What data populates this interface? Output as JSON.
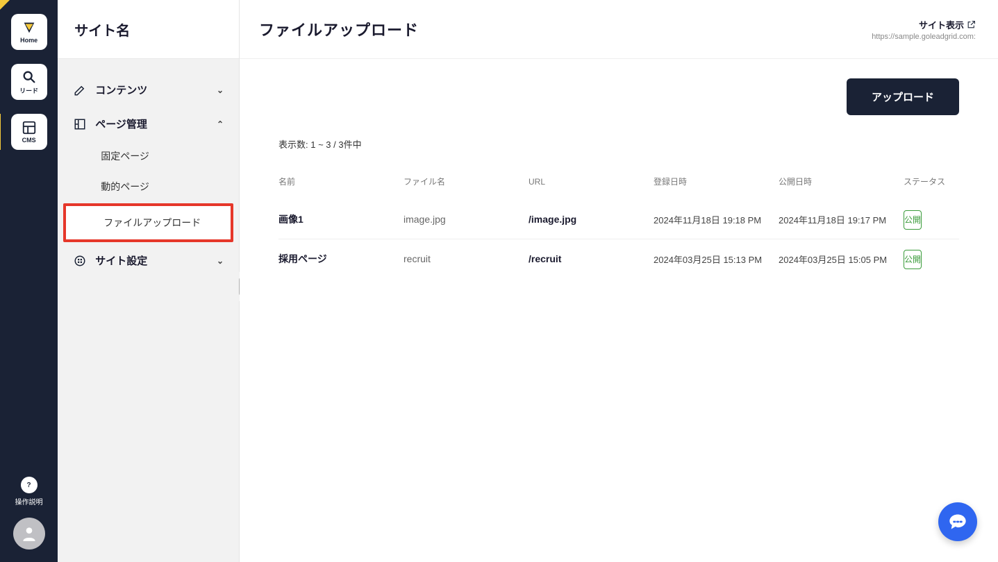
{
  "rail": {
    "home_label": "Home",
    "lead_label": "リード",
    "cms_label": "CMS",
    "help_label": "操作説明"
  },
  "sidebar": {
    "site_name": "サイト名",
    "contents_label": "コンテンツ",
    "page_mgmt_label": "ページ管理",
    "sub_fixed": "固定ページ",
    "sub_dynamic": "動的ページ",
    "sub_upload": "ファイルアップロード",
    "site_settings_label": "サイト設定"
  },
  "header": {
    "page_title": "ファイルアップロード",
    "site_view_label": "サイト表示",
    "site_url": "https://sample.goleadgrid.com:"
  },
  "actions": {
    "upload_button": "アップロード"
  },
  "list": {
    "count_text": "表示数: 1 ~ 3 / 3件中",
    "columns": {
      "name": "名前",
      "file": "ファイル名",
      "url": "URL",
      "created": "登録日時",
      "published": "公開日時",
      "status": "ステータス"
    },
    "rows": [
      {
        "name": "画像1",
        "file": "image.jpg",
        "url": "/image.jpg",
        "created": "2024年11月18日 19:18 PM",
        "published": "2024年11月18日 19:17 PM",
        "status": "公開"
      },
      {
        "name": "採用ページ",
        "file": "recruit",
        "url": "/recruit",
        "created": "2024年03月25日 15:13 PM",
        "published": "2024年03月25日 15:05 PM",
        "status": "公開"
      }
    ]
  }
}
